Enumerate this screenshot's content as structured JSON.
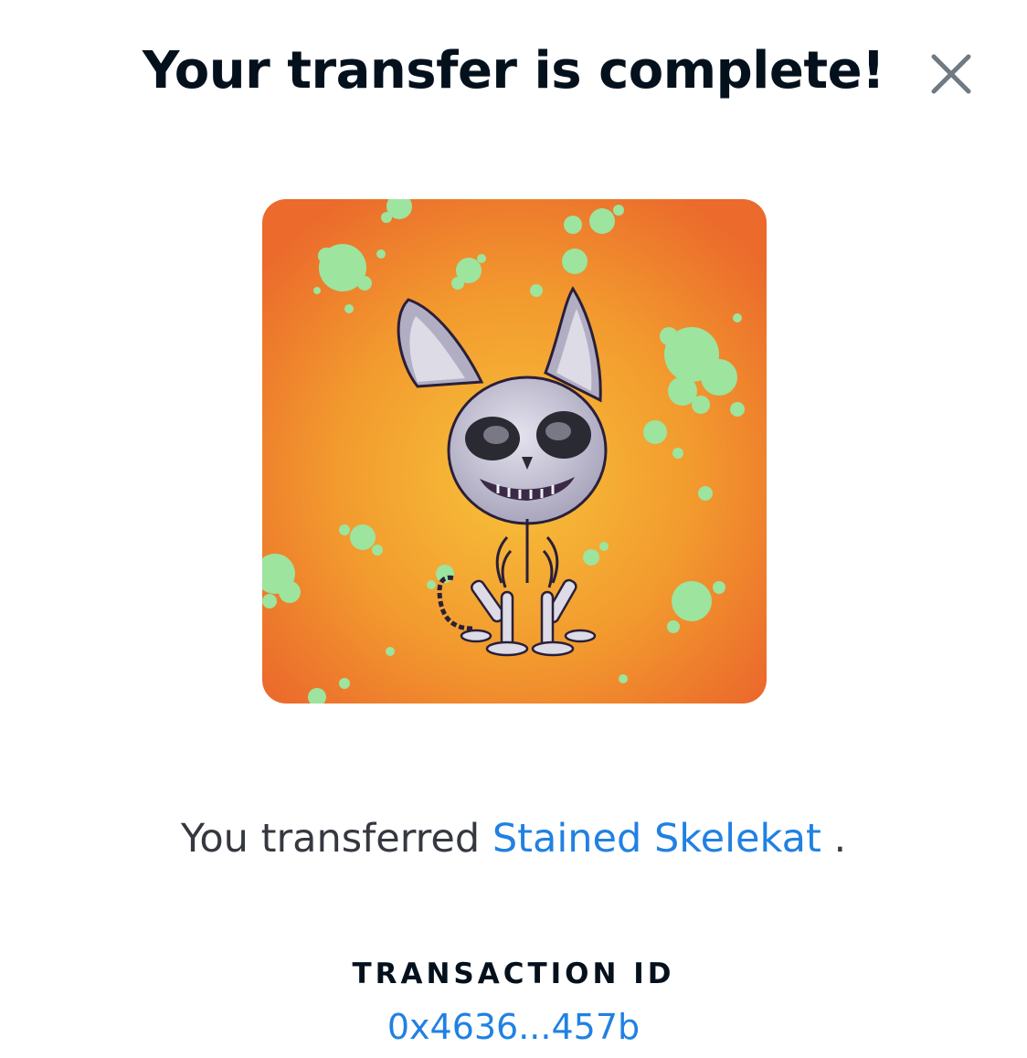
{
  "modal": {
    "title": "Your transfer is complete!",
    "close_icon": "close-icon"
  },
  "nft": {
    "image_icon": "skeleton-cat-artwork",
    "background_colors": {
      "center": "#f7c23a",
      "edge": "#eb6a2c",
      "splatter": "#9de49e"
    }
  },
  "message": {
    "prefix": "You transferred",
    "item_name": "Stained Skelekat",
    "suffix": "."
  },
  "transaction": {
    "label": "TRANSACTION ID",
    "id": "0x4636...457b"
  },
  "colors": {
    "link": "#2081e2",
    "title": "#04111d",
    "body_text": "#353840"
  }
}
